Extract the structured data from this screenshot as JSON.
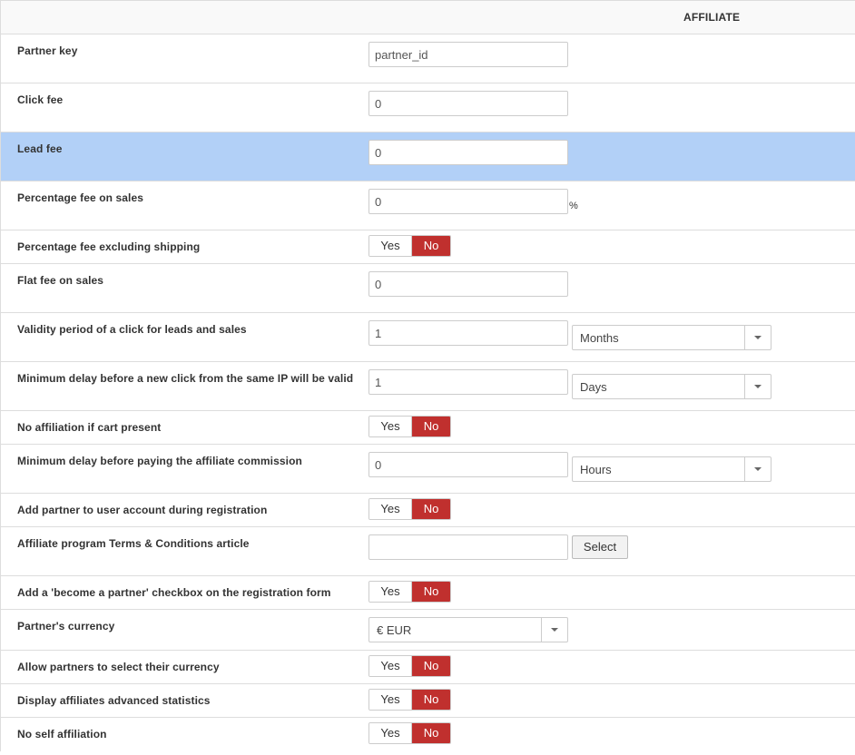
{
  "header": {
    "title": "AFFILIATE"
  },
  "toggle": {
    "yes": "Yes",
    "no": "No"
  },
  "rows": {
    "partner_key": {
      "label": "Partner key",
      "value": "partner_id"
    },
    "click_fee": {
      "label": "Click fee",
      "value": "0"
    },
    "lead_fee": {
      "label": "Lead fee",
      "value": "0"
    },
    "percentage_fee": {
      "label": "Percentage fee on sales",
      "value": "0",
      "unit": "%"
    },
    "percentage_excl_shipping": {
      "label": "Percentage fee excluding shipping",
      "selected": "No"
    },
    "flat_fee": {
      "label": "Flat fee on sales",
      "value": "0"
    },
    "validity_period": {
      "label": "Validity period of a click for leads and sales",
      "value": "1",
      "unit": "Months"
    },
    "min_delay_click": {
      "label": "Minimum delay before a new click from the same IP will be valid",
      "value": "1",
      "unit": "Days"
    },
    "no_affiliation_cart": {
      "label": "No affiliation if cart present",
      "selected": "No"
    },
    "min_delay_commission": {
      "label": "Minimum delay before paying the affiliate commission",
      "value": "0",
      "unit": "Hours"
    },
    "add_partner_registration": {
      "label": "Add partner to user account during registration",
      "selected": "No"
    },
    "terms_article": {
      "label": "Affiliate program Terms & Conditions article",
      "value": "",
      "button": "Select"
    },
    "become_partner_checkbox": {
      "label": "Add a 'become a partner' checkbox on the registration form",
      "selected": "No"
    },
    "partner_currency": {
      "label": "Partner's currency",
      "value": "€ EUR"
    },
    "allow_select_currency": {
      "label": "Allow partners to select their currency",
      "selected": "No"
    },
    "advanced_stats": {
      "label": "Display affiliates advanced statistics",
      "selected": "No"
    },
    "no_self_affiliation": {
      "label": "No self affiliation",
      "selected": "No"
    }
  },
  "colors": {
    "highlight": "#b2d0f7",
    "no_active": "#c0302e",
    "border": "#dddddd"
  }
}
